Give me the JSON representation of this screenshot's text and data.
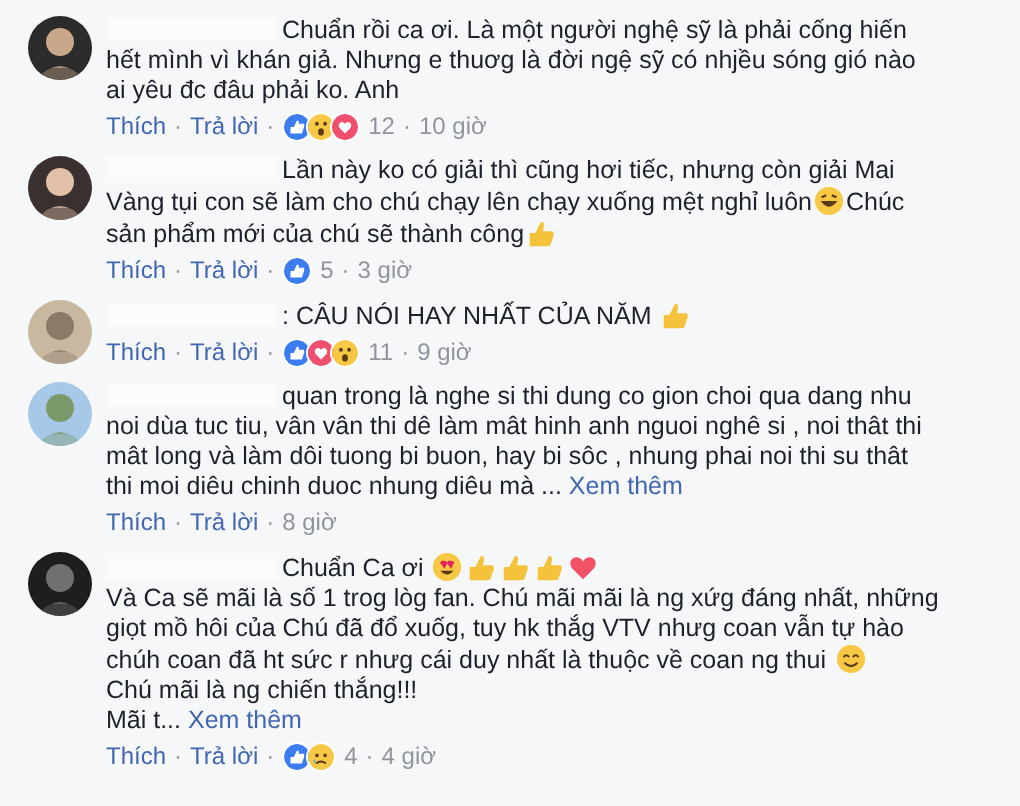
{
  "comments": [
    {
      "paragraphs": [
        [
          {
            "kind": "text",
            "text": "Chuẩn rồi ca ơi. Là một người nghệ sỹ là phải cống hiến hết mình vì khán giả. Nhưng e thuơg là đời ngệ sỹ có nhjều sóng gió nào ai yêu đc đâu phải ko. Anh"
          }
        ]
      ],
      "like": "Thích",
      "sep": "·",
      "reply": "Trả lời",
      "reactions": [
        {
          "kind": "like"
        },
        {
          "kind": "wow"
        },
        {
          "kind": "love"
        }
      ],
      "count": "12",
      "time": "10 giờ"
    },
    {
      "paragraphs": [
        [
          {
            "kind": "text",
            "text": "Lần này ko có giải thì cũng hơi tiếc, nhưng còn giải Mai Vàng tụi con sẽ làm cho chú chạy lên chạy xuống mệt nghỉ luôn"
          },
          {
            "kind": "laugh"
          },
          {
            "kind": "text",
            "text": "Chúc sản phẩm mới của chú sẽ thành công"
          },
          {
            "kind": "thumb"
          }
        ]
      ],
      "like": "Thích",
      "sep": "·",
      "reply": "Trả lời",
      "reactions": [
        {
          "kind": "like"
        }
      ],
      "count": "5",
      "time": "3 giờ"
    },
    {
      "paragraphs": [
        [
          {
            "kind": "text",
            "text": ": CÂU NÓI HAY NHẤT CỦA NĂM "
          },
          {
            "kind": "thumb"
          }
        ]
      ],
      "like": "Thích",
      "sep": "·",
      "reply": "Trả lời",
      "reactions": [
        {
          "kind": "like"
        },
        {
          "kind": "love"
        },
        {
          "kind": "wow"
        }
      ],
      "count": "11",
      "time": "9 giờ"
    },
    {
      "paragraphs": [
        [
          {
            "kind": "text",
            "text": "quan trong là nghe si thi dung co gion choi qua dang nhu noi dùa tuc tiu, vân vân thi dê làm mât hinh anh nguoi nghê si , noi thât thi mât long và làm dôi tuong bi buon, hay bi sôc , nhung phai noi thi su thât thi moi diêu chinh duoc nhung diêu mà ..."
          }
        ]
      ],
      "more": "Xem thêm",
      "like": "Thích",
      "sep": "·",
      "reply": "Trả lời",
      "time": "8 giờ"
    },
    {
      "paragraphs": [
        [
          {
            "kind": "text",
            "text": "Chuẩn Ca ơi "
          },
          {
            "kind": "hearteyes"
          },
          {
            "kind": "thumb"
          },
          {
            "kind": "thumb"
          },
          {
            "kind": "thumb"
          },
          {
            "kind": "heart"
          }
        ],
        [
          {
            "kind": "text",
            "text": "Và Ca sẽ mãi là số 1 trog lòg fan. Chú mãi mãi là ng xứg đáng nhất, những giọt mồ hôi của Chú đã đổ xuốg, tuy hk thắg VTV nhưg coan vẫn tự hào chúh coan đã ht sức r nhưg cái duy nhất là thuộc về coan ng thui "
          },
          {
            "kind": "smile"
          }
        ],
        [
          {
            "kind": "text",
            "text": "Chú mãi là ng chiến thắng!!!"
          }
        ],
        [
          {
            "kind": "text",
            "text": "Mãi t..."
          }
        ]
      ],
      "more": "Xem thêm",
      "like": "Thích",
      "sep": "·",
      "reply": "Trả lời",
      "reactions": [
        {
          "kind": "like"
        },
        {
          "kind": "sad"
        }
      ],
      "count": "4",
      "time": "4 giờ"
    }
  ]
}
